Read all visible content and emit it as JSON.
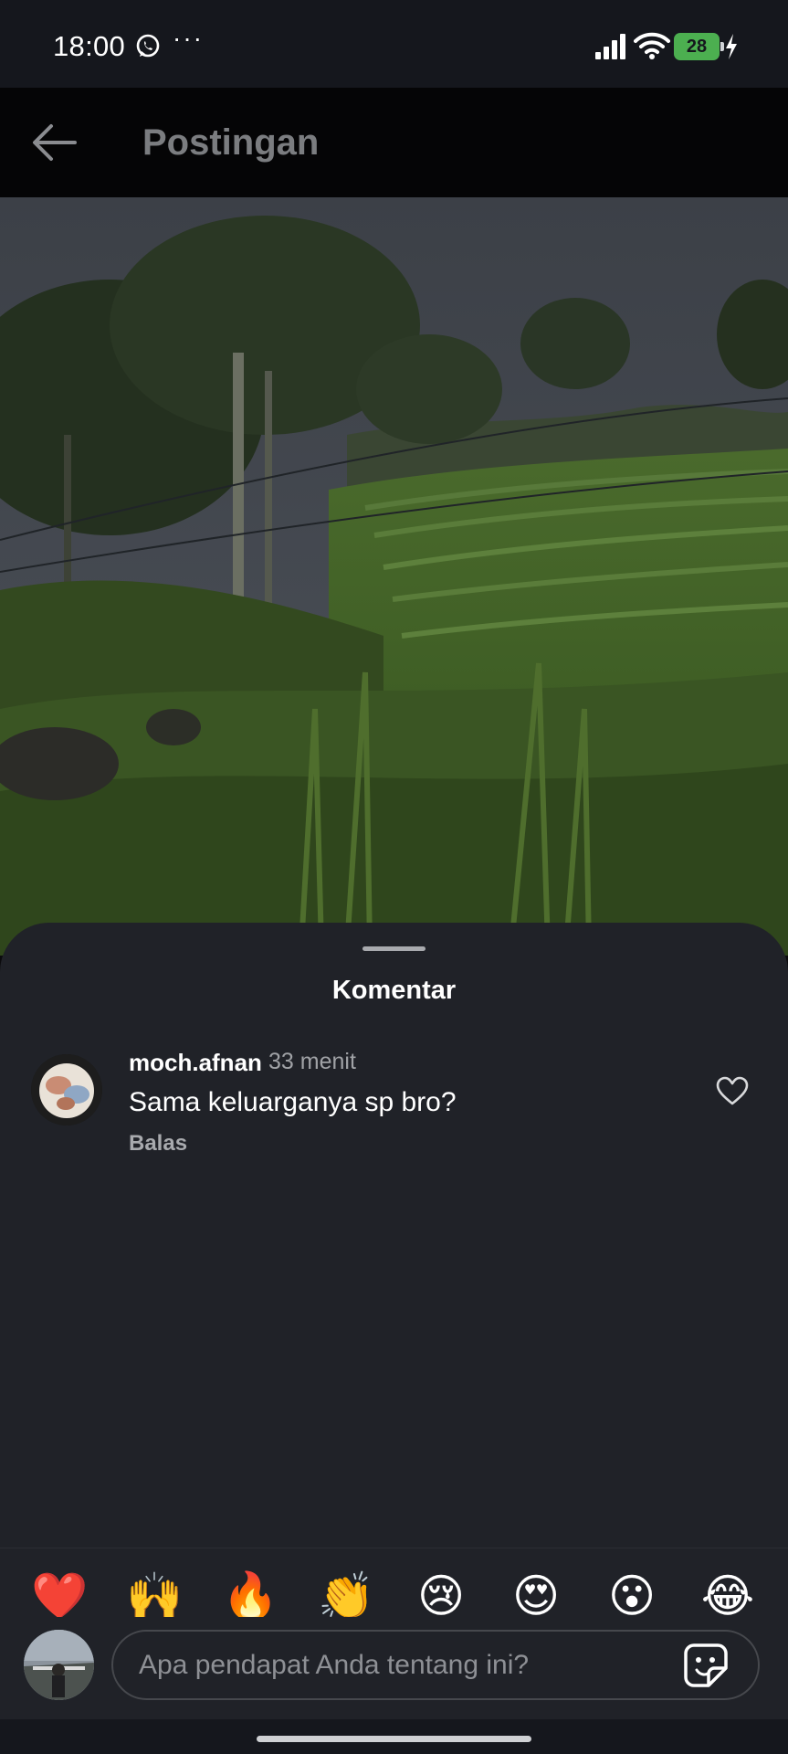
{
  "status_bar": {
    "time": "18:00",
    "battery": "28",
    "icons": [
      "whatsapp-icon",
      "more-dots-icon",
      "signal-icon",
      "wifi-icon",
      "battery-icon",
      "charging-icon"
    ]
  },
  "header": {
    "title": "Postingan",
    "back_icon": "arrow-left-icon"
  },
  "sheet": {
    "title": "Komentar"
  },
  "comments": [
    {
      "user": "moch.afnan",
      "time": "33 menit",
      "text": "Sama keluarganya sp bro?",
      "reply_label": "Balas",
      "like_icon": "heart-outline-icon"
    }
  ],
  "emoji_bar": [
    "❤️",
    "🙌",
    "🔥",
    "👏",
    "😢",
    "😍",
    "😮",
    "😂"
  ],
  "input": {
    "value": "",
    "placeholder": "Apa pendapat Anda tentang ini?",
    "sticker_icon": "sticker-icon"
  },
  "colors": {
    "sheet_bg": "#202228",
    "header_bg": "#050506",
    "status_bg": "#15171d",
    "battery_green": "#4caf50"
  }
}
